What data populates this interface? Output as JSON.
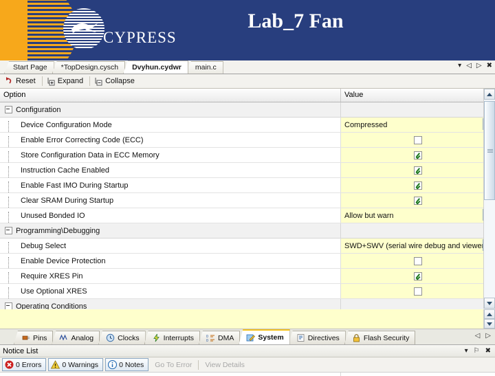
{
  "banner": {
    "title": "Lab_7 Fan",
    "logo_text": "CYPRESS",
    "logo_icon": "cypress-globe-bird-logo"
  },
  "tabstrip": {
    "tabs": [
      {
        "label": "Start Page",
        "active": false
      },
      {
        "label": "*TopDesign.cysch",
        "active": false
      },
      {
        "label": "Dvyhun.cydwr",
        "active": true
      },
      {
        "label": "main.c",
        "active": false
      }
    ],
    "controls": [
      {
        "name": "tab-list-dropdown",
        "glyph": "▾"
      },
      {
        "name": "scroll-tabs-left",
        "glyph": "◁"
      },
      {
        "name": "scroll-tabs-right",
        "glyph": "▷"
      },
      {
        "name": "close-tab",
        "glyph": "✖"
      }
    ]
  },
  "toolbar": {
    "items": [
      {
        "label": "Reset",
        "icon": "reset-arrow-icon"
      },
      {
        "label": "Expand",
        "icon": "expand-plus-icon"
      },
      {
        "label": "Collapse",
        "icon": "collapse-minus-icon"
      }
    ]
  },
  "grid": {
    "columns": [
      "Option",
      "Value"
    ],
    "rows": [
      {
        "type": "group",
        "label": "Configuration",
        "expanded": true,
        "value_type": "none"
      },
      {
        "type": "item",
        "label": "Device Configuration Mode",
        "value_type": "dropdown",
        "value": "Compressed"
      },
      {
        "type": "item",
        "label": "Enable Error Correcting Code (ECC)",
        "value_type": "checkbox",
        "checked": false
      },
      {
        "type": "item",
        "label": "Store Configuration Data in ECC Memory",
        "value_type": "checkbox",
        "checked": true
      },
      {
        "type": "item",
        "label": "Instruction Cache Enabled",
        "value_type": "checkbox",
        "checked": true
      },
      {
        "type": "item",
        "label": "Enable Fast IMO During Startup",
        "value_type": "checkbox",
        "checked": true
      },
      {
        "type": "item",
        "label": "Clear SRAM During Startup",
        "value_type": "checkbox",
        "checked": true
      },
      {
        "type": "item",
        "label": "Unused Bonded IO",
        "value_type": "dropdown",
        "value": "Allow but warn"
      },
      {
        "type": "group",
        "label": "Programming\\Debugging",
        "expanded": true,
        "value_type": "none"
      },
      {
        "type": "item",
        "label": "Debug Select",
        "value_type": "dropdown",
        "value": "SWD+SWV (serial wire debug and viewer)"
      },
      {
        "type": "item",
        "label": "Enable Device Protection",
        "value_type": "checkbox",
        "checked": false
      },
      {
        "type": "item",
        "label": "Require XRES Pin",
        "value_type": "checkbox",
        "checked": true
      },
      {
        "type": "item",
        "label": "Use Optional XRES",
        "value_type": "checkbox",
        "checked": false
      },
      {
        "type": "group",
        "label": "Operating Conditions",
        "expanded": true,
        "value_type": "none"
      }
    ]
  },
  "description_panel": {
    "text": ""
  },
  "view_tabs": {
    "tabs": [
      {
        "label": "Pins",
        "icon": "pins-icon",
        "active": false
      },
      {
        "label": "Analog",
        "icon": "analog-wave-icon",
        "active": false
      },
      {
        "label": "Clocks",
        "icon": "clock-icon",
        "active": false
      },
      {
        "label": "Interrupts",
        "icon": "lightning-icon",
        "active": false
      },
      {
        "label": "DMA",
        "icon": "dma-icon",
        "active": false
      },
      {
        "label": "System",
        "icon": "system-pencil-icon",
        "active": true
      },
      {
        "label": "Directives",
        "icon": "directives-icon",
        "active": false
      },
      {
        "label": "Flash Security",
        "icon": "lock-icon",
        "active": false
      }
    ],
    "controls": [
      {
        "name": "scroll-view-tabs-left",
        "glyph": "◁"
      },
      {
        "name": "scroll-view-tabs-right",
        "glyph": "▷"
      }
    ]
  },
  "notice_list": {
    "title": "Notice List",
    "header_controls": [
      {
        "name": "panel-menu",
        "glyph": "▾"
      },
      {
        "name": "pin-panel",
        "glyph": "⚐"
      },
      {
        "name": "close-panel",
        "glyph": "✖"
      }
    ],
    "buttons": [
      {
        "label": "0 Errors",
        "icon": "error-icon"
      },
      {
        "label": "0 Warnings",
        "icon": "warning-icon"
      },
      {
        "label": "0 Notes",
        "icon": "note-icon"
      }
    ],
    "actions": [
      {
        "label": "Go To Error",
        "enabled": false
      },
      {
        "label": "View Details",
        "enabled": false
      }
    ]
  },
  "colors": {
    "banner_navy": "#283e7e",
    "banner_orange": "#f7a81b",
    "editable_cell": "#feffcc",
    "active_tab_accent": "#f5c21b",
    "error_red": "#cc2020",
    "warning_yellow": "#f2cf3b",
    "note_blue": "#2a6fb5"
  }
}
